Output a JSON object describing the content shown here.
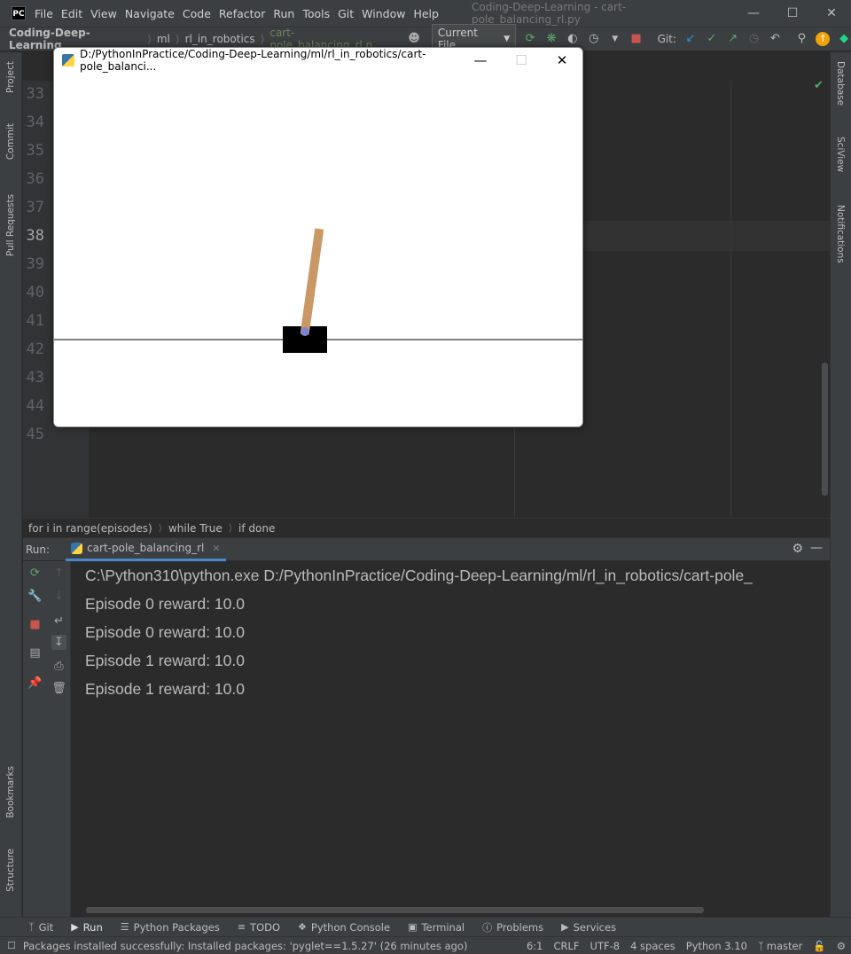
{
  "app": {
    "logo_text": "PC",
    "window_title": "Coding-Deep-Learning - cart-pole_balancing_rl.py",
    "menu": [
      "File",
      "Edit",
      "View",
      "Navigate",
      "Code",
      "Refactor",
      "Run",
      "Tools",
      "Git",
      "Window",
      "Help"
    ]
  },
  "navbar": {
    "crumbs": [
      "Coding-Deep-Learning",
      "ml",
      "rl_in_robotics",
      "cart-pole_balancing_rl.p"
    ],
    "run_config": "Current File",
    "git_label": "Git:"
  },
  "left_stripe": [
    "Project",
    "Commit",
    "Pull Requests",
    "Bookmarks",
    "Structure"
  ],
  "right_stripe": [
    "Database",
    "SciView",
    "Notifications"
  ],
  "editor": {
    "line_numbers": [
      "33",
      "34",
      "35",
      "36",
      "37",
      "38",
      "39",
      "40",
      "41",
      "42",
      "43",
      "44",
      "45"
    ],
    "current_line": "38"
  },
  "game_window": {
    "title": "D:/PythonInPractice/Coding-Deep-Learning/ml/rl_in_robotics/cart-pole_balanci...",
    "pole_angle_deg": 8,
    "colors": {
      "cart": "#000000",
      "pole": "#ca9865",
      "axle": "#8184cb",
      "track": "#000000",
      "bg": "#ffffff"
    }
  },
  "code_breadcrumbs": [
    "for i in range(episodes)",
    "while True",
    "if done"
  ],
  "run_panel": {
    "label": "Run:",
    "tab": "cart-pole_balancing_rl",
    "output": [
      "C:\\Python310\\python.exe D:/PythonInPractice/Coding-Deep-Learning/ml/rl_in_robotics/cart-pole_",
      "Episode 0 reward: 10.0",
      "Episode 0 reward: 10.0",
      "Episode 1 reward: 10.0",
      "Episode 1 reward: 10.0"
    ]
  },
  "bottom_tools": [
    "Git",
    "Run",
    "Python Packages",
    "TODO",
    "Python Console",
    "Terminal",
    "Problems",
    "Services"
  ],
  "status": {
    "message": "Packages installed successfully: Installed packages: 'pyglet==1.5.27' (26 minutes ago)",
    "position": "6:1",
    "line_sep": "CRLF",
    "encoding": "UTF-8",
    "indent": "4 spaces",
    "interpreter": "Python 3.10",
    "branch": "master"
  }
}
